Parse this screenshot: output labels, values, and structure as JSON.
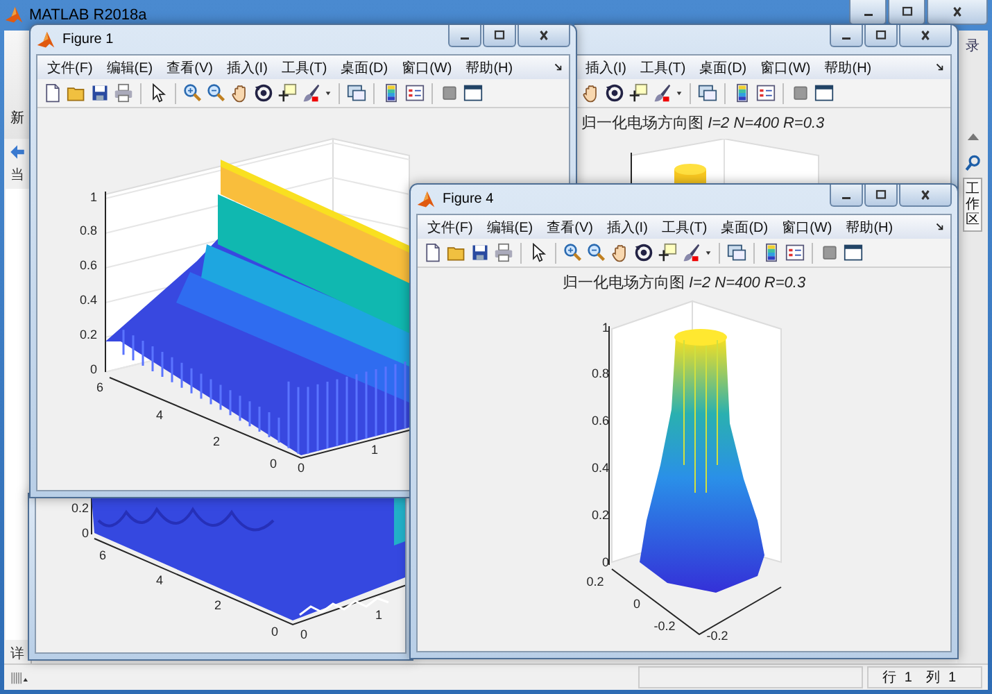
{
  "main_window": {
    "title": "MATLAB R2018a",
    "ribbon_label": "新",
    "current_folder_label": "当",
    "details_label": "详",
    "top_right_label": "录",
    "side_tab": "工作区",
    "status_bar": [
      {
        "label": "行",
        "value": "1"
      },
      {
        "label": "列",
        "value": "1"
      }
    ]
  },
  "figures": [
    {
      "kind": "full",
      "title": "Figure 1",
      "menu": [
        "文件(F)",
        "编辑(E)",
        "查看(V)",
        "插入(I)",
        "工具(T)",
        "桌面(D)",
        "窗口(W)",
        "帮助(H)"
      ],
      "plot": {
        "kind": "ridge",
        "z_ticks": [
          "1",
          "0.8",
          "0.6",
          "0.4",
          "0.2",
          "0"
        ],
        "y_ticks": [
          "6",
          "4",
          "2",
          "0"
        ],
        "x_ticks": [
          "0",
          "1"
        ]
      }
    },
    {
      "kind": "clipped_right",
      "menu": [
        "插入(I)",
        "工具(T)",
        "桌面(D)",
        "窗口(W)",
        "帮助(H)"
      ],
      "plot": {
        "kind": "cylinder",
        "title": "归一化电场方向图 *I=2 N=400 R=0.3*"
      }
    },
    {
      "kind": "clipped_bottom",
      "plot": {
        "kind": "ripple",
        "z_ticks": [
          "0.2",
          "0"
        ],
        "y_ticks": [
          "6",
          "4",
          "2",
          "0"
        ],
        "x_ticks": [
          "0",
          "1"
        ]
      }
    },
    {
      "kind": "full",
      "title": "Figure 4",
      "menu": [
        "文件(F)",
        "编辑(E)",
        "查看(V)",
        "插入(I)",
        "工具(T)",
        "桌面(D)",
        "窗口(W)",
        "帮助(H)"
      ],
      "plot": {
        "kind": "cone",
        "title": "归一化电场方向图 *I=2 N=400 R=0.3*",
        "z_ticks": [
          "1",
          "0.8",
          "0.6",
          "0.4",
          "0.2",
          "0"
        ],
        "y_ticks": [
          "0.2",
          "0",
          "-0.2"
        ],
        "x_ticks": [
          "-0.2"
        ]
      }
    }
  ]
}
